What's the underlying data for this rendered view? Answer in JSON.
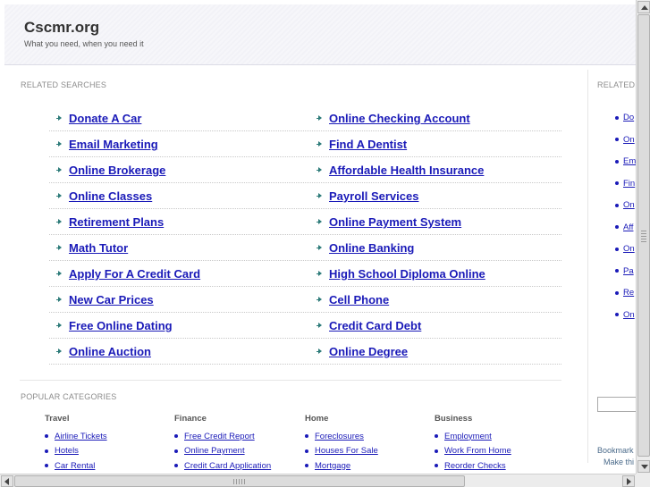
{
  "header": {
    "title": "Cscmr.org",
    "tagline": "What you need, when you need it"
  },
  "related": {
    "label": "RELATED SEARCHES",
    "rows": [
      [
        "Donate A Car",
        "Online Checking Account"
      ],
      [
        "Email Marketing",
        "Find A Dentist"
      ],
      [
        "Online Brokerage",
        "Affordable Health Insurance"
      ],
      [
        "Online Classes",
        "Payroll Services"
      ],
      [
        "Retirement Plans",
        "Online Payment System"
      ],
      [
        "Math Tutor",
        "Online Banking"
      ],
      [
        "Apply For A Credit Card",
        "High School Diploma Online"
      ],
      [
        "New Car Prices",
        "Cell Phone"
      ],
      [
        "Free Online Dating",
        "Credit Card Debt"
      ],
      [
        "Online Auction",
        "Online Degree"
      ]
    ]
  },
  "popular": {
    "label": "POPULAR CATEGORIES",
    "columns": [
      {
        "heading": "Travel",
        "items": [
          "Airline Tickets",
          "Hotels",
          "Car Rental"
        ]
      },
      {
        "heading": "Finance",
        "items": [
          "Free Credit Report",
          "Online Payment",
          "Credit Card Application"
        ]
      },
      {
        "heading": "Home",
        "items": [
          "Foreclosures",
          "Houses For Sale",
          "Mortgage"
        ]
      },
      {
        "heading": "Business",
        "items": [
          "Employment",
          "Work From Home",
          "Reorder Checks"
        ]
      }
    ]
  },
  "right_panel": {
    "label": "RELATED",
    "items": [
      "Do",
      "On",
      "Em",
      "Fin",
      "On",
      "Aff",
      "On",
      "Pa",
      "Re",
      "On"
    ],
    "bookmark": "Bookmark",
    "make": "Make thi"
  },
  "colors": {
    "link": "#1a1ab8",
    "arrow": "#2b7a78",
    "header_bg": "#f2f2f7",
    "label": "#8c8c8c"
  }
}
